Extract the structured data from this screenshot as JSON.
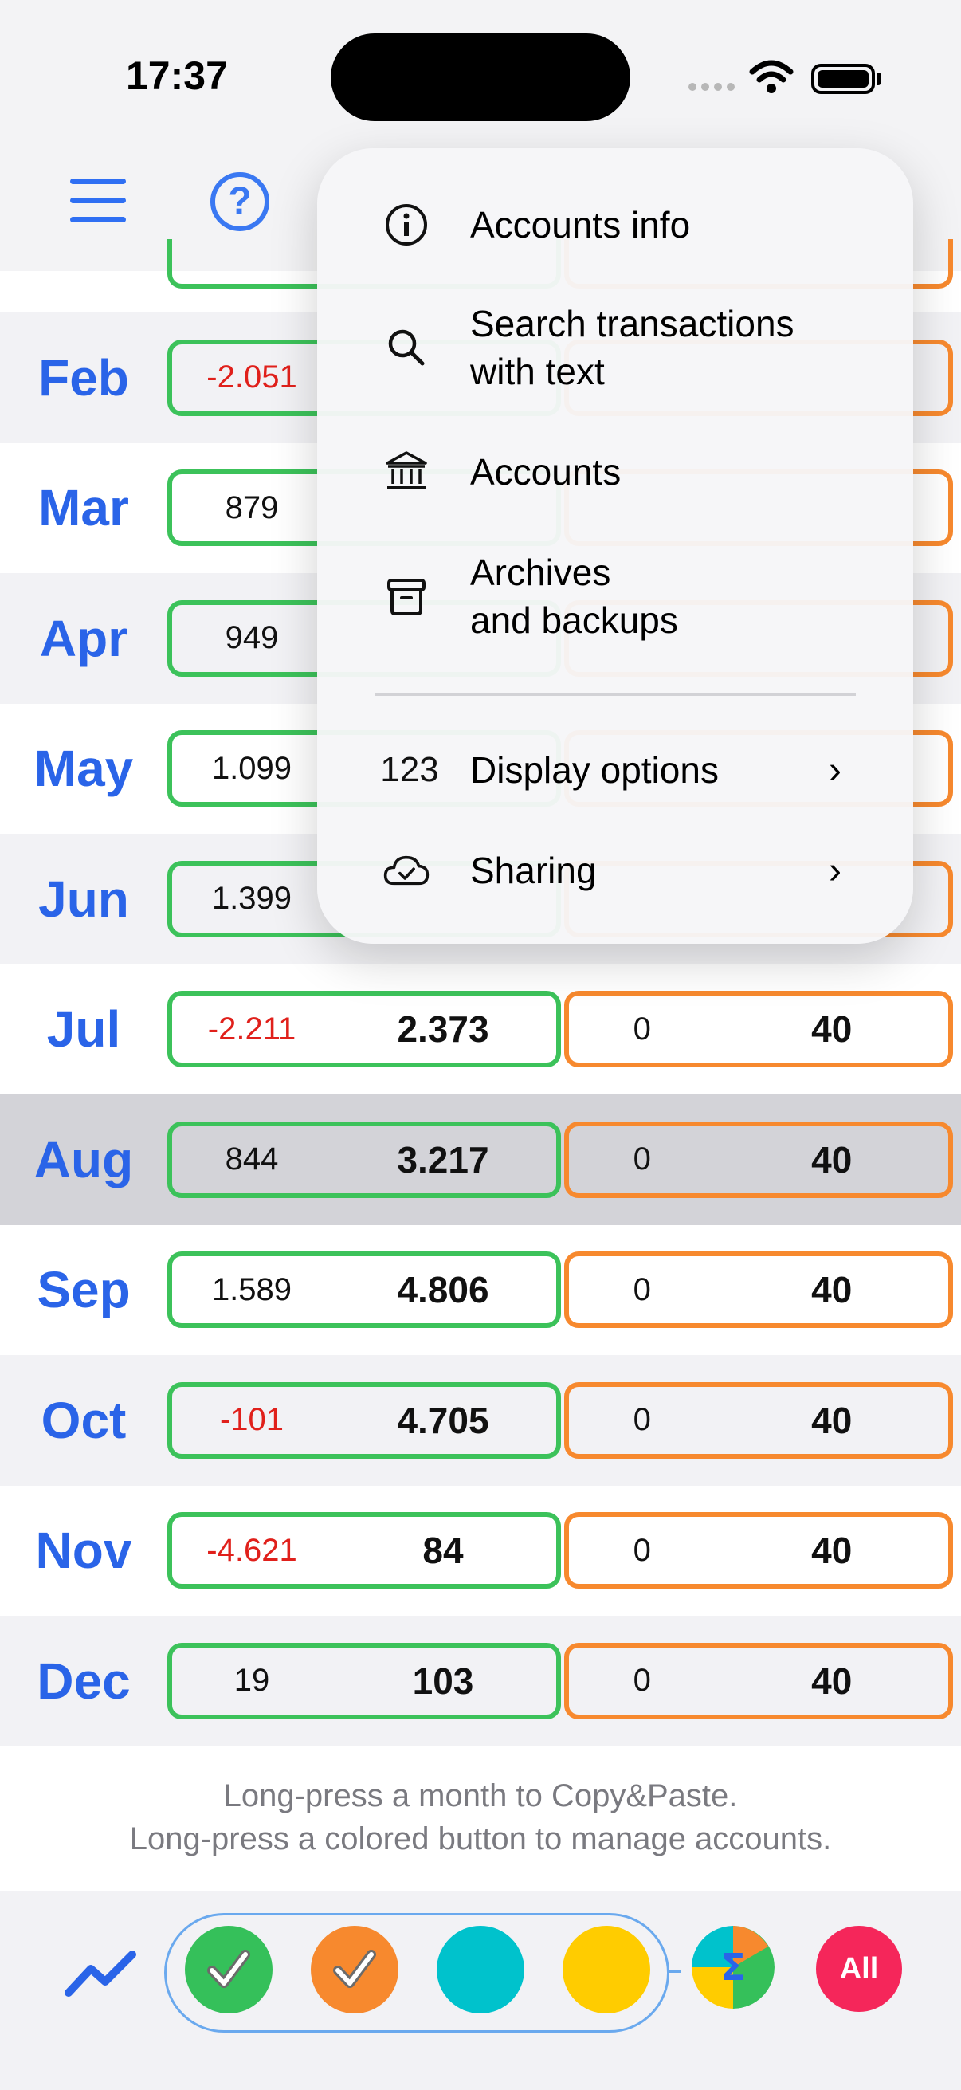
{
  "status_bar": {
    "time": "17:37"
  },
  "months": [
    {
      "label": "Feb",
      "v1": "-2.051",
      "v1_negative": true,
      "v2": "",
      "o1": "",
      "o2": ""
    },
    {
      "label": "Mar",
      "v1": "879",
      "v1_negative": false,
      "v2": "",
      "o1": "",
      "o2": ""
    },
    {
      "label": "Apr",
      "v1": "949",
      "v1_negative": false,
      "v2": "",
      "o1": "",
      "o2": ""
    },
    {
      "label": "May",
      "v1": "1.099",
      "v1_negative": false,
      "v2": "",
      "o1": "",
      "o2": ""
    },
    {
      "label": "Jun",
      "v1": "1.399",
      "v1_negative": false,
      "v2": "",
      "o1": "",
      "o2": ""
    },
    {
      "label": "Jul",
      "v1": "-2.211",
      "v1_negative": true,
      "v2": "2.373",
      "o1": "0",
      "o2": "40"
    },
    {
      "label": "Aug",
      "v1": "844",
      "v1_negative": false,
      "v2": "3.217",
      "o1": "0",
      "o2": "40",
      "selected": true
    },
    {
      "label": "Sep",
      "v1": "1.589",
      "v1_negative": false,
      "v2": "4.806",
      "o1": "0",
      "o2": "40"
    },
    {
      "label": "Oct",
      "v1": "-101",
      "v1_negative": true,
      "v2": "4.705",
      "o1": "0",
      "o2": "40"
    },
    {
      "label": "Nov",
      "v1": "-4.621",
      "v1_negative": true,
      "v2": "84",
      "o1": "0",
      "o2": "40"
    },
    {
      "label": "Dec",
      "v1": "19",
      "v1_negative": false,
      "v2": "103",
      "o1": "0",
      "o2": "40"
    }
  ],
  "hint": {
    "line1": "Long-press a month to Copy&Paste.",
    "line2": "Long-press a colored button to manage accounts."
  },
  "menu": {
    "items": [
      {
        "label": "Accounts info",
        "icon": "info-icon"
      },
      {
        "label": "Search transactions\nwith text",
        "icon": "search-icon"
      },
      {
        "label": "Accounts",
        "icon": "bank-icon"
      },
      {
        "label": "Archives\nand backups",
        "icon": "archive-icon"
      },
      {
        "label": "Display options",
        "icon": "numbers-icon",
        "icon_text": "123",
        "submenu": true
      },
      {
        "label": "Sharing",
        "icon": "cloud-check-icon",
        "submenu": true
      }
    ]
  },
  "bottom_bar": {
    "all_label": "All",
    "accounts": [
      {
        "color": "#35c05a",
        "checked": true
      },
      {
        "color": "#f7892e",
        "checked": true
      },
      {
        "color": "#00c2cc",
        "checked": false
      },
      {
        "color": "#ffcc00",
        "checked": false
      }
    ]
  },
  "colors": {
    "accent": "#2a64e8",
    "green_border": "#3cc25a",
    "orange_border": "#f7892e",
    "negative": "#e0201b",
    "all_button": "#f5265a"
  }
}
